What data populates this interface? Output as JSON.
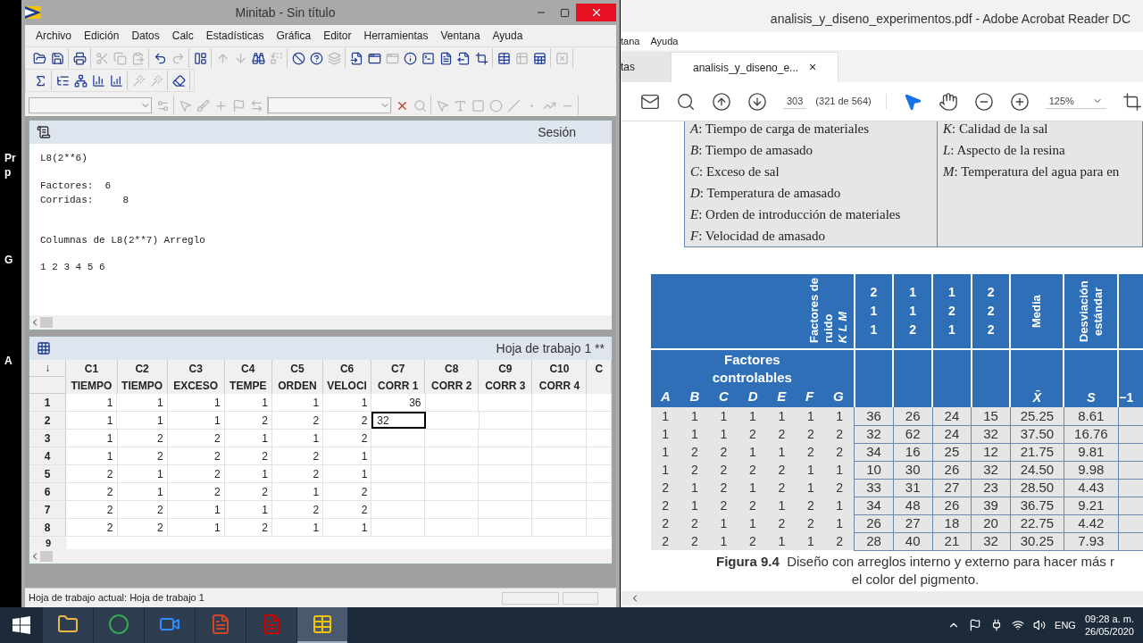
{
  "desktop_labels": [
    "Pr",
    "p",
    "G",
    "A"
  ],
  "minitab": {
    "title": "Minitab - Sin título",
    "menu": [
      "Archivo",
      "Edición",
      "Datos",
      "Calc",
      "Estadísticas",
      "Gráfica",
      "Editor",
      "Herramientas",
      "Ventana",
      "Ayuda"
    ],
    "toolbars": [
      {
        "groups": [
          {
            "disabled": [
              false,
              false
            ]
          },
          {
            "disabled": [
              false
            ]
          },
          {
            "disabled": [
              true,
              true,
              true
            ]
          },
          {
            "disabled": [
              false,
              true
            ]
          },
          {
            "disabled": [
              false
            ]
          },
          {
            "disabled": [
              true,
              true,
              false,
              true
            ]
          },
          {
            "disabled": [
              false,
              false,
              true
            ]
          },
          {
            "disabled": [
              false,
              false,
              true,
              false,
              false,
              false,
              false,
              false
            ]
          },
          {
            "disabled": [
              false,
              true,
              false
            ]
          },
          {
            "disabled": [
              true
            ]
          }
        ]
      },
      {
        "groups": [
          {
            "disabled": [
              false
            ]
          },
          {
            "disabled": [
              false,
              false,
              false,
              false
            ]
          },
          {
            "disabled": [
              true,
              true
            ]
          },
          {
            "disabled": [
              false
            ]
          }
        ]
      },
      {
        "groups": [
          {
            "disabled": [
              true
            ]
          },
          {
            "disabled": [
              true,
              true,
              true,
              true,
              true
            ]
          },
          {
            "disabled": [
              false,
              true
            ]
          },
          {
            "disabled": [
              true,
              true,
              true,
              true,
              true,
              true,
              true,
              true
            ]
          }
        ]
      }
    ],
    "session": {
      "title": "Sesión",
      "blocks": [
        "L8(2**6)",
        "Factores:  6\nCorridas:     8",
        "Columnas de L8(2**7) Arreglo",
        "1 2 3 4 5 6"
      ]
    },
    "worksheet": {
      "title": "Hoja de trabajo 1 **",
      "corner": "↓",
      "columns": [
        {
          "id": "C1",
          "name": "TIEMPO"
        },
        {
          "id": "C2",
          "name": "TIEMPO"
        },
        {
          "id": "C3",
          "name": "EXCESO"
        },
        {
          "id": "C4",
          "name": "TEMPE"
        },
        {
          "id": "C5",
          "name": "ORDEN"
        },
        {
          "id": "C6",
          "name": "VELOCI"
        },
        {
          "id": "C7",
          "name": "CORR 1"
        },
        {
          "id": "C8",
          "name": "CORR 2"
        },
        {
          "id": "C9",
          "name": "CORR 3"
        },
        {
          "id": "C10",
          "name": "CORR 4"
        },
        {
          "id": "C"
        }
      ],
      "rows": [
        {
          "number": "1",
          "cells": [
            {
              "value": "1",
              "selected": false
            },
            {
              "value": "1",
              "selected": false
            },
            {
              "value": "1",
              "selected": false
            },
            {
              "value": "1",
              "selected": false
            },
            {
              "value": "1",
              "selected": false
            },
            {
              "value": "1",
              "selected": false
            },
            {
              "value": "36",
              "selected": false
            }
          ]
        },
        {
          "number": "2",
          "cells": [
            {
              "value": "1",
              "selected": false
            },
            {
              "value": "1",
              "selected": false
            },
            {
              "value": "1",
              "selected": false
            },
            {
              "value": "2",
              "selected": false
            },
            {
              "value": "2",
              "selected": false
            },
            {
              "value": "2",
              "selected": false
            },
            {
              "value": "32",
              "selected": true
            }
          ]
        },
        {
          "number": "3",
          "cells": [
            {
              "value": "1",
              "selected": false
            },
            {
              "value": "2",
              "selected": false
            },
            {
              "value": "2",
              "selected": false
            },
            {
              "value": "1",
              "selected": false
            },
            {
              "value": "1",
              "selected": false
            },
            {
              "value": "2",
              "selected": false
            },
            {
              "selected": false
            }
          ]
        },
        {
          "number": "4",
          "cells": [
            {
              "value": "1",
              "selected": false
            },
            {
              "value": "2",
              "selected": false
            },
            {
              "value": "2",
              "selected": false
            },
            {
              "value": "2",
              "selected": false
            },
            {
              "value": "2",
              "selected": false
            },
            {
              "value": "1",
              "selected": false
            },
            {
              "selected": false
            }
          ]
        },
        {
          "number": "5",
          "cells": [
            {
              "value": "2",
              "selected": false
            },
            {
              "value": "1",
              "selected": false
            },
            {
              "value": "2",
              "selected": false
            },
            {
              "value": "1",
              "selected": false
            },
            {
              "value": "2",
              "selected": false
            },
            {
              "value": "1",
              "selected": false
            },
            {
              "selected": false
            }
          ]
        },
        {
          "number": "6",
          "cells": [
            {
              "value": "2",
              "selected": false
            },
            {
              "value": "1",
              "selected": false
            },
            {
              "value": "2",
              "selected": false
            },
            {
              "value": "2",
              "selected": false
            },
            {
              "value": "1",
              "selected": false
            },
            {
              "value": "2",
              "selected": false
            },
            {
              "selected": false
            }
          ]
        },
        {
          "number": "7",
          "cells": [
            {
              "value": "2",
              "selected": false
            },
            {
              "value": "2",
              "selected": false
            },
            {
              "value": "1",
              "selected": false
            },
            {
              "value": "1",
              "selected": false
            },
            {
              "value": "2",
              "selected": false
            },
            {
              "value": "2",
              "selected": false
            },
            {
              "selected": false
            }
          ]
        },
        {
          "number": "8",
          "cells": [
            {
              "value": "2",
              "selected": false
            },
            {
              "value": "2",
              "selected": false
            },
            {
              "value": "1",
              "selected": false
            },
            {
              "value": "2",
              "selected": false
            },
            {
              "value": "1",
              "selected": false
            },
            {
              "value": "1",
              "selected": false
            },
            {
              "selected": false
            }
          ]
        }
      ],
      "partial_row": "9"
    },
    "status_bar": "Hoja de trabajo actual: Hoja de trabajo 1"
  },
  "acrobat": {
    "title": "analisis_y_diseno_experimentos.pdf - Adobe Acrobat Reader DC",
    "menu": [
      "tana",
      "Ayuda"
    ],
    "tabs": [
      {
        "label": "tas",
        "selected": false
      },
      {
        "label": "analisis_y_diseno_e...",
        "selected": true,
        "close": "×"
      }
    ],
    "page_number": "303",
    "page_of": "(321 de 564)",
    "zoom": "125%",
    "factor_list_left": [
      "*A*: Tiempo de carga de materiales",
      "*B*: Tiempo de amasado",
      "*C*: Exceso de sal",
      "*D*: Temperatura de amasado",
      "*E*: Orden de introducción de materiales",
      "*F*: Velocidad de amasado"
    ],
    "factor_list_right": [
      "*K*: Calidad de la sal",
      "*L*: Aspecto de la resina",
      "*M*: Temperatura del agua para en"
    ],
    "table": {
      "noise_header": "Factores de ruido",
      "noise_letters": "K L M",
      "noise_columns": [
        [
          "2",
          "1",
          "1"
        ],
        [
          "1",
          "1",
          "2"
        ],
        [
          "1",
          "2",
          "1"
        ],
        [
          "2",
          "2",
          "2"
        ]
      ],
      "stat_headers": [
        {
          "label": "Media",
          "symbol": "X̄"
        },
        {
          "label": "Desviación estándar",
          "symbol": "S"
        }
      ],
      "partial_symbol": "−1",
      "controllable_header": "Factores controlables",
      "factors": [
        "A",
        "B",
        "C",
        "D",
        "E",
        "F",
        "G"
      ],
      "rows": [
        [
          "1",
          "1",
          "1",
          "1",
          "1",
          "1",
          "1",
          "36",
          "26",
          "24",
          "15",
          "25.25",
          "8.61"
        ],
        [
          "1",
          "1",
          "1",
          "2",
          "2",
          "2",
          "2",
          "32",
          "62",
          "24",
          "32",
          "37.50",
          "16.76"
        ],
        [
          "1",
          "2",
          "2",
          "1",
          "1",
          "2",
          "2",
          "34",
          "16",
          "25",
          "12",
          "21.75",
          "9.81"
        ],
        [
          "1",
          "2",
          "2",
          "2",
          "2",
          "1",
          "1",
          "10",
          "30",
          "26",
          "32",
          "24.50",
          "9.98"
        ],
        [
          "2",
          "1",
          "2",
          "1",
          "2",
          "1",
          "2",
          "33",
          "31",
          "27",
          "23",
          "28.50",
          "4.43"
        ],
        [
          "2",
          "1",
          "2",
          "2",
          "1",
          "2",
          "1",
          "34",
          "48",
          "26",
          "39",
          "36.75",
          "9.21"
        ],
        [
          "2",
          "2",
          "1",
          "1",
          "2",
          "2",
          "1",
          "26",
          "27",
          "18",
          "20",
          "22.75",
          "4.42"
        ],
        [
          "2",
          "2",
          "1",
          "2",
          "1",
          "1",
          "2",
          "28",
          "40",
          "21",
          "32",
          "30.25",
          "7.93"
        ]
      ]
    },
    "caption": "**Figura 9.4**  Diseño con arreglos interno y externo para hacer más r\nel color del pigmento."
  },
  "taskbar": {
    "apps": [
      {
        "selected": false
      },
      {
        "selected": false
      },
      {
        "selected": false
      },
      {
        "selected": false
      },
      {
        "selected": false
      },
      {
        "selected": true
      }
    ],
    "language": "ENG",
    "time": "09:28 a. m.",
    "date": "26/05/2020"
  }
}
